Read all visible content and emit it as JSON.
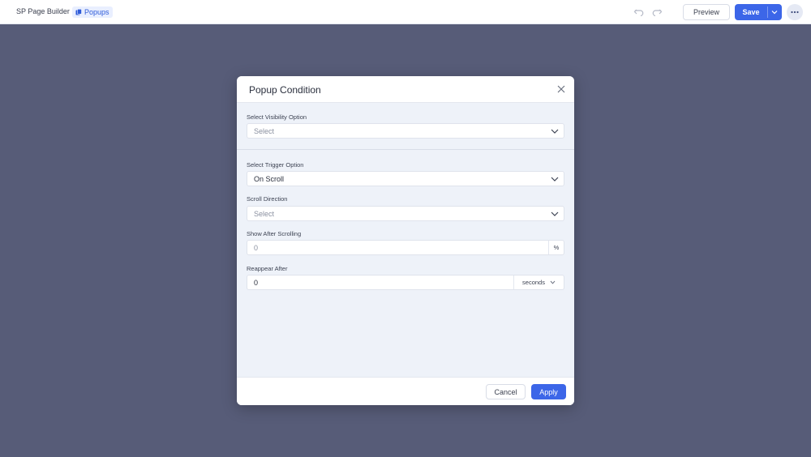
{
  "header": {
    "brand": "SP Page Builder",
    "section_tag": "Popups",
    "preview_label": "Preview",
    "save_label": "Save"
  },
  "icons": {
    "tag": "page-icon",
    "undo": "undo-icon",
    "redo": "redo-icon",
    "save_menu": "chevron-down-icon",
    "more": "more-dots-icon",
    "close": "close-icon",
    "dropdown": "chevron-down-icon"
  },
  "colors": {
    "accent": "#3c66e8",
    "overlay": "#575c78",
    "modal_body": "#eef2f9"
  },
  "modal": {
    "title": "Popup Condition",
    "visibility": {
      "label": "Select Visibility Option",
      "value": "",
      "placeholder": "Select"
    },
    "trigger": {
      "label": "Select Trigger Option",
      "value": "On Scroll"
    },
    "scroll_direction": {
      "label": "Scroll Direction",
      "value": "",
      "placeholder": "Select"
    },
    "show_after": {
      "label": "Show After Scrolling",
      "value": "",
      "placeholder": "0",
      "unit": "%"
    },
    "reappear": {
      "label": "Reappear After",
      "value": "0",
      "unit": "seconds"
    },
    "cancel_label": "Cancel",
    "apply_label": "Apply"
  }
}
